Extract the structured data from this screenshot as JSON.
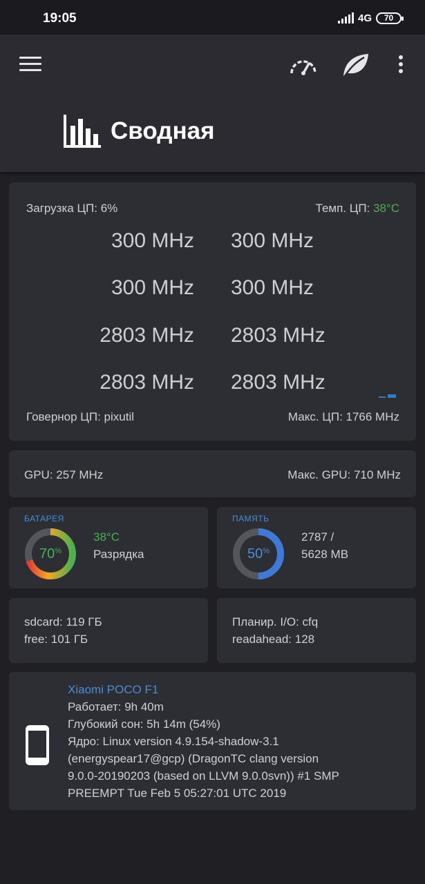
{
  "status_bar": {
    "time": "19:05",
    "network": "4G",
    "battery_level": "70"
  },
  "header": {
    "title": "Сводная",
    "icons": [
      "menu-icon",
      "gauge-icon",
      "leaf-icon",
      "more-vert-icon",
      "bar-chart-icon"
    ]
  },
  "cpu": {
    "load_label": "Загрузка ЦП: 6%",
    "temp_label": "Темп. ЦП:",
    "temp_value": "38°C",
    "freqs": [
      "300 MHz",
      "300 MHz",
      "300 MHz",
      "300 MHz",
      "2803 MHz",
      "2803 MHz",
      "2803 MHz",
      "2803 MHz"
    ],
    "governor": "Говернор ЦП: pixutil",
    "max": "Макс. ЦП: 1766 MHz"
  },
  "gpu": {
    "freq": "GPU: 257 MHz",
    "max": "Макс. GPU: 710 MHz"
  },
  "battery": {
    "heading": "БАТАРЕЯ",
    "percent": "70",
    "percent_sign": "%",
    "level_fraction": 0.7,
    "temperature": "38°C",
    "status": "Разрядка"
  },
  "memory": {
    "heading": "ПАМЯТЬ",
    "percent": "50",
    "percent_sign": "%",
    "level_fraction": 0.5,
    "used": "2787 /",
    "total": "5628 MB"
  },
  "storage": {
    "sdcard": "sdcard: 119 ГБ",
    "free": "free: 101 ГБ"
  },
  "io": {
    "scheduler": "Планир. I/O: cfq",
    "readahead": "readahead: 128"
  },
  "device": {
    "name": "Xiaomi POCO F1",
    "uptime": "Работает: 9h 40m",
    "deep_sleep": "Глубокий сон: 5h 14m  (54%)",
    "kernel_lines": [
      "Ядро: Linux version 4.9.154-shadow-3.1",
      "(energyspear17@gcp) (DragonTC clang version",
      "9.0.0-20190203 (based on LLVM 9.0.0svn)) #1 SMP",
      "PREEMPT Tue Feb 5 05:27:01 UTC 2019"
    ]
  },
  "colors": {
    "accent_blue": "#4a8cd8",
    "green": "#4caf50",
    "card": "#2d2d34",
    "background": "#1f1f24"
  }
}
